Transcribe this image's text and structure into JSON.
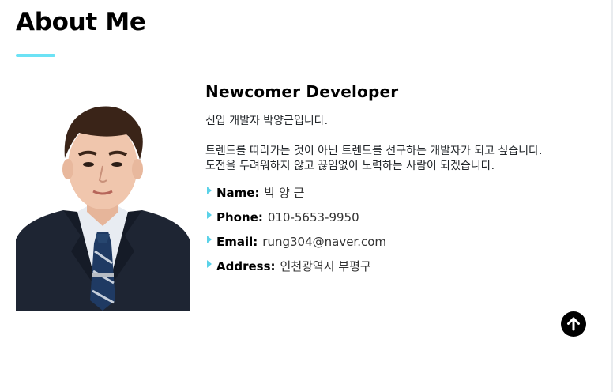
{
  "section": {
    "title": "About Me"
  },
  "profile": {
    "headline": "Newcomer Developer",
    "intro_lines": [
      "신입 개발자 박양근입니다.",
      "트렌드를 따라가는 것이 아닌 트렌드를 선구하는 개발자가 되고 싶습니다.",
      "도전을 두려워하지 않고 끊임없이 노력하는 사람이 되겠습니다."
    ],
    "details": [
      {
        "key": "Name:",
        "value": "박 양 근"
      },
      {
        "key": "Phone:",
        "value": "010-5653-9950"
      },
      {
        "key": "Email:",
        "value": "rung304@naver.com"
      },
      {
        "key": "Address:",
        "value": "인천광역시 부평구"
      }
    ]
  },
  "icons": {
    "bullet": "caret-right-icon",
    "scroll_top": "arrow-up-icon"
  },
  "colors": {
    "accent": "#6ce2f5",
    "scroll_button": "#000000"
  }
}
